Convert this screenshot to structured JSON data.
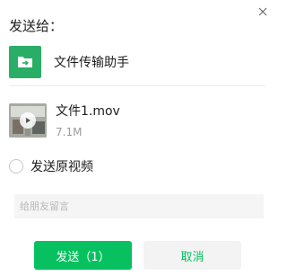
{
  "dialog": {
    "title": "发送给：",
    "close_icon": "close-icon"
  },
  "recipient": {
    "name": "文件传输助手",
    "icon": "file-transfer-icon",
    "color": "#2aae67"
  },
  "file": {
    "name": "文件1.mov",
    "size": "7.1M",
    "thumb_icon": "play-icon"
  },
  "option": {
    "label": "发送原视频",
    "checked": false
  },
  "message": {
    "placeholder": "给朋友留言",
    "value": ""
  },
  "buttons": {
    "send_label": "发送（1）",
    "cancel_label": "取消",
    "send_color": "#07c160",
    "cancel_text_color": "#07c160"
  }
}
